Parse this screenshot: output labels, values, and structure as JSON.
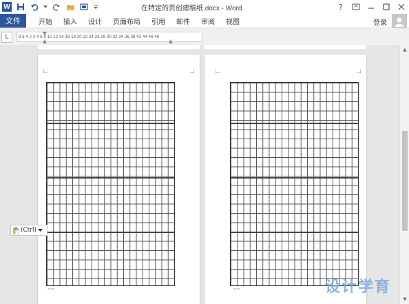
{
  "window": {
    "title": "在特定的页创建稿纸.docx - Word",
    "app_icon": "W",
    "help": "?"
  },
  "ribbon": {
    "file_tab": "文件",
    "tabs": [
      "开始",
      "插入",
      "设计",
      "页面布局",
      "引用",
      "邮件",
      "审阅",
      "视图"
    ],
    "login": "登录"
  },
  "ruler": {
    "corner": "L",
    "ticks": "8 6 4 2   2 4 6 8 10 12 14 16 18 20 22 24 26 28 30 32 34 36 38   42 44 46 48"
  },
  "paste_options": {
    "label": "(Ctrl)"
  },
  "pages": {
    "left_footer": "20×20",
    "right_footer": "20×20"
  },
  "watermark": "设计学育",
  "colors": {
    "accent": "#2b579a",
    "watermark": "#7aa8dc"
  }
}
